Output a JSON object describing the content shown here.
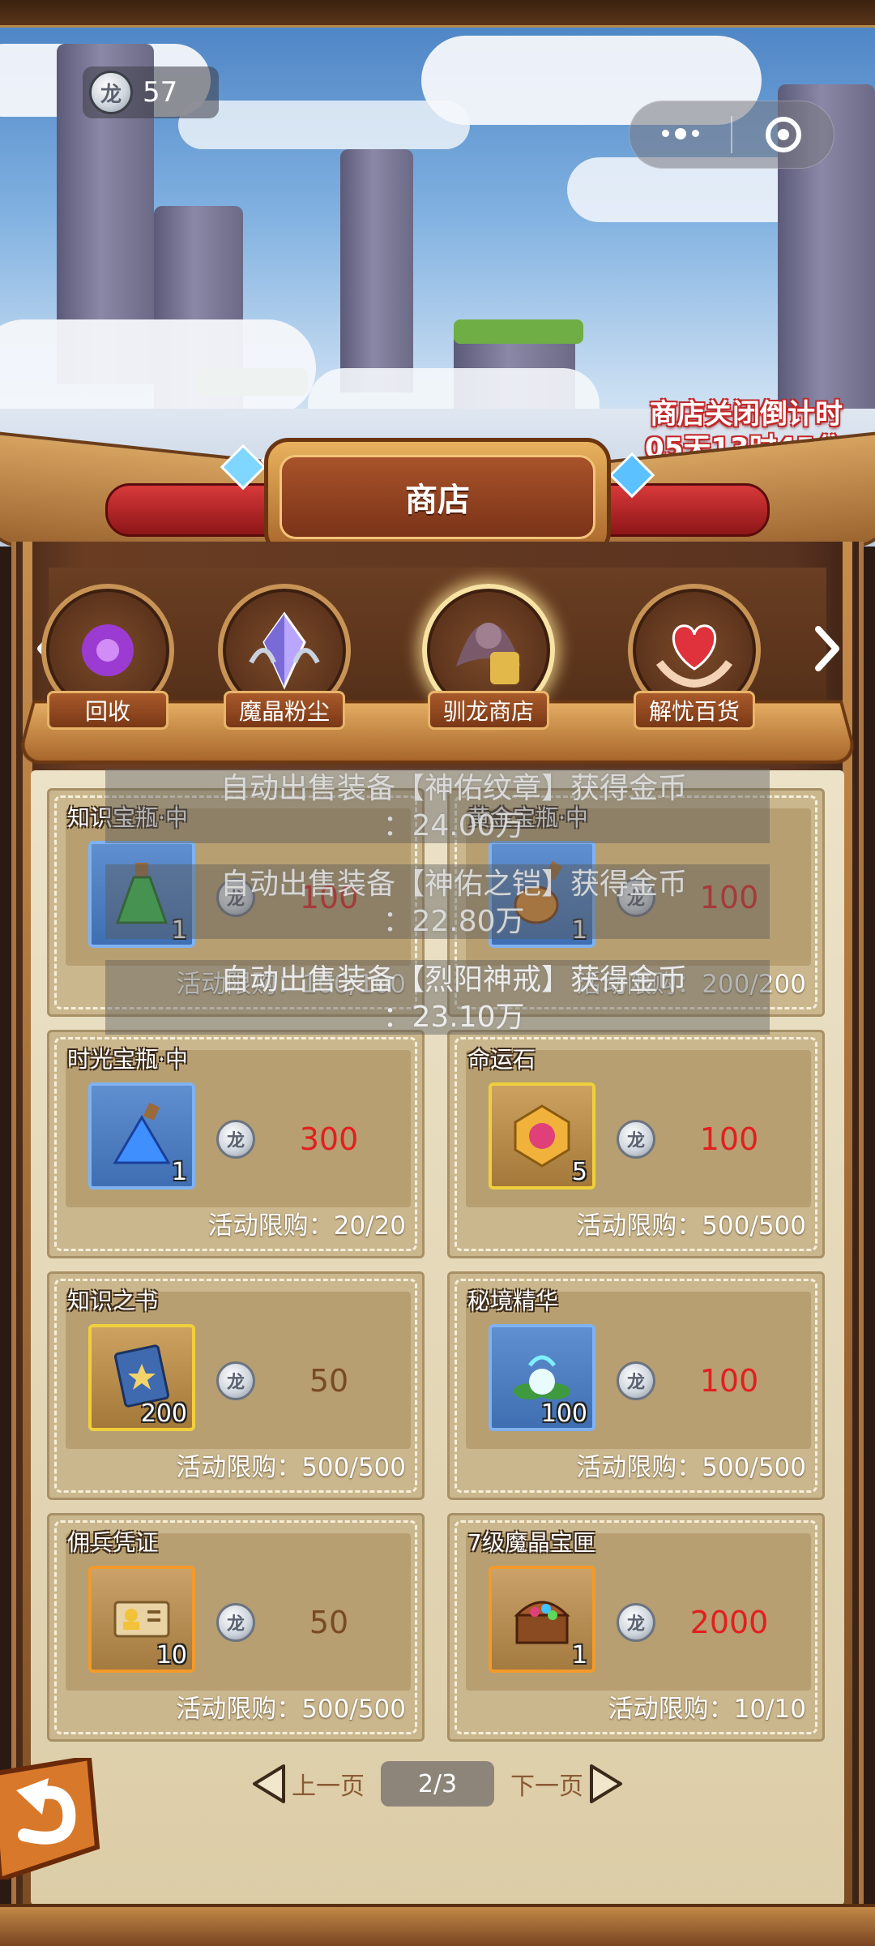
{
  "currency": {
    "amount": "57",
    "icon": "silver-dragon-coin"
  },
  "countdown": {
    "line1": "商店关闭倒计时",
    "line2": "05天13时45分"
  },
  "shop_title": "商店",
  "tabs": [
    {
      "label": "回收",
      "icon": "recycle-flower-icon",
      "active": false
    },
    {
      "label": "魔晶粉尘",
      "icon": "crystal-dust-icon",
      "active": false
    },
    {
      "label": "驯龙商店",
      "icon": "dragon-shop-icon",
      "active": true
    },
    {
      "label": "解忧百货",
      "icon": "heart-hands-icon",
      "active": false
    }
  ],
  "items": [
    {
      "name": "知识宝瓶·中",
      "qty": "1",
      "price": "100",
      "limit": "活动限购：100/100",
      "icon": "green-potion-icon",
      "frame": "blue",
      "price_color": "red"
    },
    {
      "name": "黄金宝瓶·中",
      "qty": "1",
      "price": "100",
      "limit": "活动限购：200/200",
      "icon": "gold-potion-icon",
      "frame": "blue",
      "price_color": "red"
    },
    {
      "name": "时光宝瓶·中",
      "qty": "1",
      "price": "300",
      "limit": "活动限购：20/20",
      "icon": "blue-potion-icon",
      "frame": "blue",
      "price_color": "red"
    },
    {
      "name": "命运石",
      "qty": "5",
      "price": "100",
      "limit": "活动限购：500/500",
      "icon": "fate-stone-icon",
      "frame": "gold",
      "price_color": "red"
    },
    {
      "name": "知识之书",
      "qty": "200",
      "price": "50",
      "limit": "活动限购：500/500",
      "icon": "book-icon",
      "frame": "gold",
      "price_color": "brown"
    },
    {
      "name": "秘境精华",
      "qty": "100",
      "price": "100",
      "limit": "活动限购：500/500",
      "icon": "essence-flower-icon",
      "frame": "blue",
      "price_color": "red"
    },
    {
      "name": "佣兵凭证",
      "qty": "10",
      "price": "50",
      "limit": "活动限购：500/500",
      "icon": "mercenary-ticket-icon",
      "frame": "orange",
      "price_color": "brown"
    },
    {
      "name": "7级魔晶宝匣",
      "qty": "1",
      "price": "2000",
      "limit": "活动限购：10/10",
      "icon": "treasure-chest-icon",
      "frame": "orange",
      "price_color": "red"
    }
  ],
  "toasts": [
    {
      "line1": "自动出售装备【神佑纹章】获得金币",
      "line2": "：24.00万"
    },
    {
      "line1": "自动出售装备【神佑之铠】获得金币",
      "line2": "：22.80万"
    },
    {
      "line1": "自动出售装备【烈阳神戒】获得金币",
      "line2": "：23.10万"
    }
  ],
  "pager": {
    "prev": "上一页",
    "next": "下一页",
    "current": "2/3"
  },
  "colors": {
    "price_red": "#e21f1f",
    "price_brown": "#7a4a22",
    "countdown_outline": "#c3282a"
  }
}
